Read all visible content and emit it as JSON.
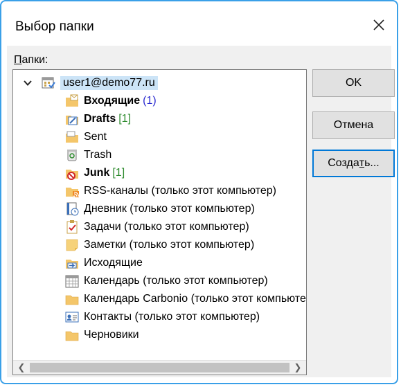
{
  "window": {
    "title": "Выбор папки"
  },
  "folders_label": "Папки:",
  "root": {
    "label": "user1@demo77.ru"
  },
  "folders": [
    {
      "label": "Входящие",
      "count": "(1)",
      "count_color": "blue",
      "bold": true,
      "icon": "inbox-icon"
    },
    {
      "label": "Drafts",
      "count": "[1]",
      "count_color": "green",
      "bold": true,
      "icon": "drafts-icon"
    },
    {
      "label": "Sent",
      "count": "",
      "bold": false,
      "icon": "sent-icon"
    },
    {
      "label": "Trash",
      "count": "",
      "bold": false,
      "icon": "trash-icon"
    },
    {
      "label": "Junk",
      "count": "[1]",
      "count_color": "green",
      "bold": true,
      "icon": "junk-icon"
    },
    {
      "label": "RSS-каналы (только этот компьютер)",
      "count": "",
      "bold": false,
      "icon": "rss-icon"
    },
    {
      "label": "Дневник (только этот компьютер)",
      "count": "",
      "bold": false,
      "icon": "journal-icon"
    },
    {
      "label": "Задачи (только этот компьютер)",
      "count": "",
      "bold": false,
      "icon": "tasks-icon"
    },
    {
      "label": "Заметки (только этот компьютер)",
      "count": "",
      "bold": false,
      "icon": "notes-icon"
    },
    {
      "label": "Исходящие",
      "count": "",
      "bold": false,
      "icon": "outbox-icon"
    },
    {
      "label": "Календарь (только этот компьютер)",
      "count": "",
      "bold": false,
      "icon": "calendar-icon"
    },
    {
      "label": "Календарь Carbonio (только этот компьютер)",
      "count": "",
      "bold": false,
      "icon": "folder-icon"
    },
    {
      "label": "Контакты (только этот компьютер)",
      "count": "",
      "bold": false,
      "icon": "contacts-icon"
    },
    {
      "label": "Черновики",
      "count": "",
      "bold": false,
      "icon": "folder-icon"
    }
  ],
  "buttons": {
    "ok": "OK",
    "cancel": "Отмена",
    "create": "Создать..."
  },
  "colors": {
    "accent": "#3aa0e8",
    "selection": "#cce4f7",
    "count_blue": "#2b2bd0",
    "count_green": "#2e8b2e"
  }
}
